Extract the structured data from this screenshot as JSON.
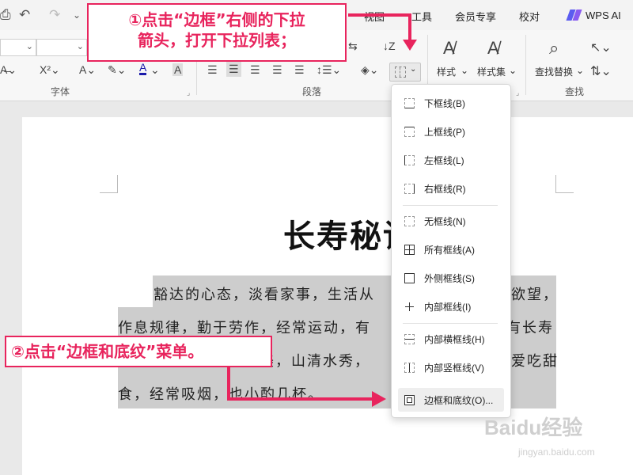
{
  "ribbon": {
    "tabs": [
      "视图",
      "工具",
      "会员专享",
      "校对"
    ],
    "wps_ai": "WPS AI",
    "groups": {
      "font": "字体",
      "paragraph": "段落",
      "find": "查找"
    },
    "tools": {
      "styles": "样式",
      "style_set": "样式集",
      "find_replace": "查找替换"
    },
    "accent_color": "#e8245d"
  },
  "dropdown": {
    "items": [
      "下框线(B)",
      "上框线(P)",
      "左框线(L)",
      "右框线(R)",
      "无框线(N)",
      "所有框线(A)",
      "外侧框线(S)",
      "内部框线(I)",
      "内部横框线(H)",
      "内部竖框线(V)",
      "边框和底纹(O)..."
    ]
  },
  "document": {
    "title": "长寿秘诀",
    "lines": [
      "豁达的心态，淡看家事，生活从",
      "欲望，",
      "作息规律，勤于劳作，经常运动，有",
      "有长寿",
      "美，山清水秀，",
      "爱吃甜",
      "食，经常吸烟，也小酌几杯。"
    ]
  },
  "callouts": {
    "step1": "①点击“边框”右侧的下拉箭头，打开下拉列表；",
    "step1_line1": "①点击“边框”右侧的下拉",
    "step1_line2": "箭头，打开下拉列表；",
    "step2": "②点击“边框和底纹”菜单。"
  },
  "watermark": {
    "main": "Baidu经验",
    "sub": "jingyan.baidu.com"
  }
}
